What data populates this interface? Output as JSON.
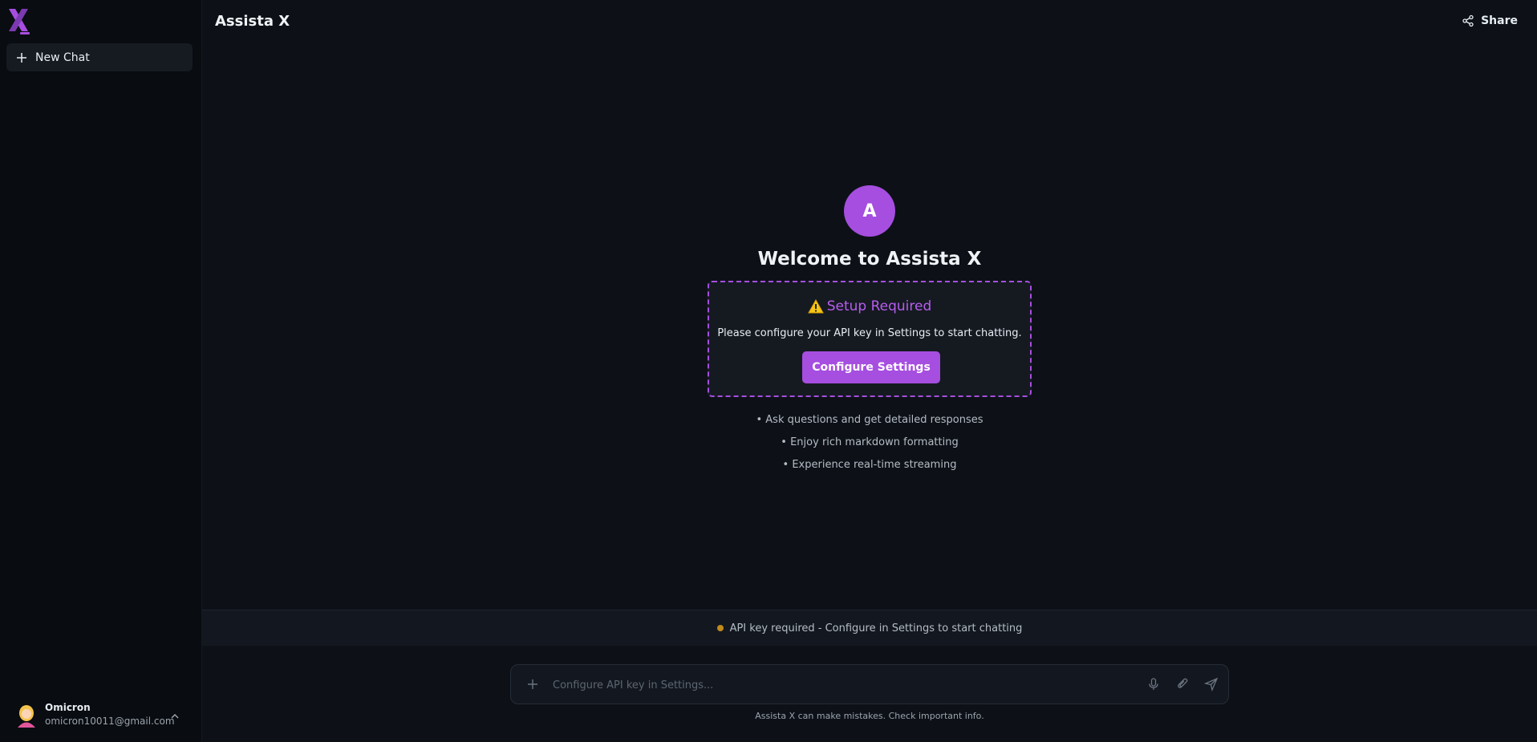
{
  "sidebar": {
    "logo_icon": "x-chat-logo-icon",
    "new_chat_label": "New Chat",
    "user": {
      "name": "Omicron",
      "email": "omicron10011@gmail.com"
    }
  },
  "header": {
    "title": "Assista X",
    "share_label": "Share"
  },
  "welcome": {
    "avatar_letter": "A",
    "title": "Welcome to Assista X",
    "setup": {
      "title": "Setup Required",
      "message": "Please configure your API key in Settings to start chatting.",
      "button_label": "Configure Settings"
    },
    "features": [
      "• Ask questions and get detailed responses",
      "• Enjoy rich markdown formatting",
      "• Experience real-time streaming"
    ]
  },
  "status": {
    "text": "API key required - Configure in Settings to start chatting",
    "dot_color": "#c08a1d"
  },
  "composer": {
    "placeholder": "Configure API key in Settings...",
    "disclaimer": "Assista X can make mistakes. Check important info."
  },
  "colors": {
    "accent": "#a64ee0",
    "background": "#0d1117",
    "sidebar": "#090c10"
  }
}
